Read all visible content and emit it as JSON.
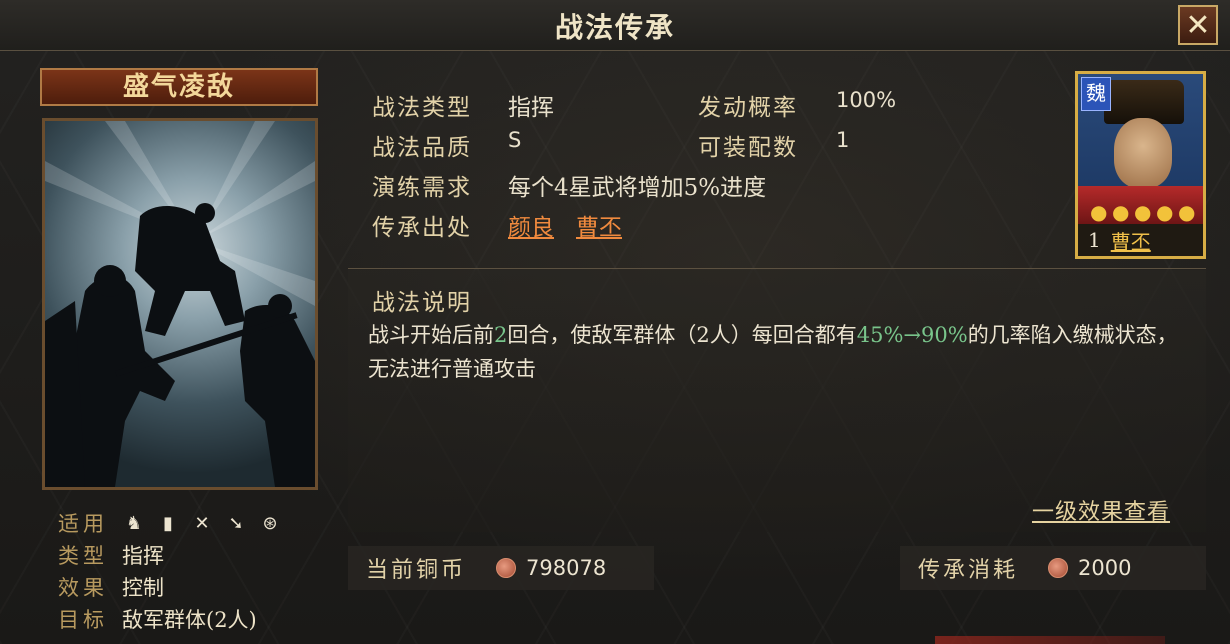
{
  "window": {
    "title": "战法传承",
    "close_icon": "close-x-icon"
  },
  "skill": {
    "name": "盛气凌敌",
    "stats": [
      {
        "label": "适用",
        "value": ""
      },
      {
        "label": "类型",
        "value": "指挥"
      },
      {
        "label": "效果",
        "value": "控制"
      },
      {
        "label": "目标",
        "value": "敌军群体(2人)"
      }
    ],
    "troop_icons": [
      "cavalry-icon",
      "shield-icon",
      "bow-icon",
      "spear-icon",
      "siege-icon"
    ]
  },
  "info": {
    "type_label": "战法类型",
    "type_value": "指挥",
    "rate_label": "发动概率",
    "rate_value": "100%",
    "quality_label": "战法品质",
    "quality_value": "S",
    "slots_label": "可装配数",
    "slots_value": "1",
    "drill_label": "演练需求",
    "drill_value": "每个4星武将增加5%进度",
    "source_label": "传承出处",
    "sources": [
      "颜良",
      "曹丕"
    ]
  },
  "description": {
    "title": "战法说明",
    "text_pre": "战斗开始后前",
    "text_rounds": "2",
    "text_mid": "回合，使敌军群体（2人）每回合都有",
    "text_rate": "45%→90%",
    "text_post": "的几率陷入缴械状态，无法进行普通攻击",
    "more_link": "一级效果查看"
  },
  "general": {
    "faction": "魏",
    "level": "1",
    "name": "曹丕",
    "stars": 5
  },
  "currency": {
    "current_label": "当前铜币",
    "current_value": "798078",
    "cost_label": "传承消耗",
    "cost_value": "2000"
  },
  "colors": {
    "accent_orange": "#f08a3e",
    "highlight_green": "#79c58b",
    "gold": "#d7ad45"
  }
}
